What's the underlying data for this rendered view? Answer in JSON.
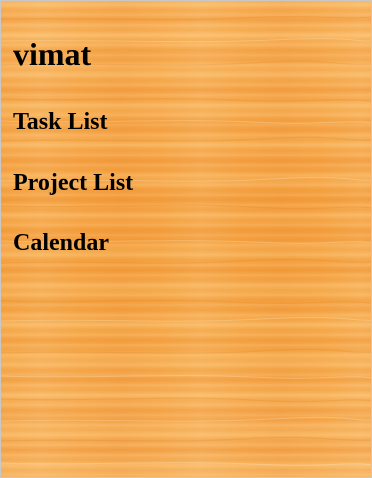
{
  "app": {
    "title": "vimat"
  },
  "nav": {
    "items": [
      {
        "label": "Task List"
      },
      {
        "label": "Project List"
      },
      {
        "label": "Calendar"
      }
    ]
  },
  "theme": {
    "background": "#f7a94a",
    "text_color": "#000000",
    "background_texture": "wood-grain"
  }
}
